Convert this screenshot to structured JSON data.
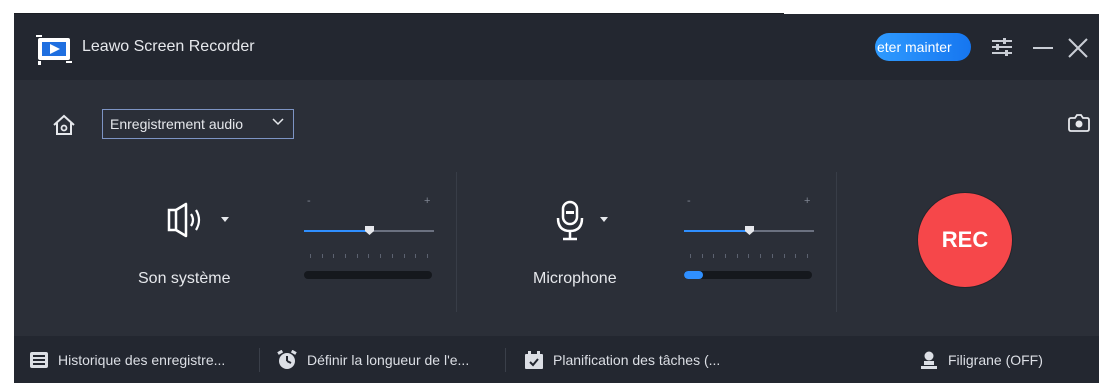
{
  "app": {
    "title": "Leawo Screen Recorder"
  },
  "header": {
    "upgrade_label": "eter mainter"
  },
  "mode": {
    "selected": "Enregistrement audio"
  },
  "sources": {
    "system": {
      "label": "Son système",
      "volume": 0.5,
      "level": 0.0,
      "minus": "-",
      "plus": "+"
    },
    "microphone": {
      "label": "Microphone",
      "volume": 0.5,
      "level": 0.15,
      "minus": "-",
      "plus": "+"
    }
  },
  "record": {
    "label": "REC"
  },
  "footer": {
    "history": "Historique des enregistre...",
    "length": "Définir la longueur de l'e...",
    "schedule": "Planification des tâches (...",
    "watermark": "Filigrane (OFF)"
  },
  "colors": {
    "accent": "#2f8fff",
    "record": "#f6474a",
    "background": "#2b2f38",
    "titlebar": "#232730"
  },
  "icons": [
    "app-logo-icon",
    "settings-icon",
    "minimize-icon",
    "close-icon",
    "home-icon",
    "chevron-down-icon",
    "camera-icon",
    "speaker-icon",
    "microphone-icon",
    "history-list-icon",
    "timer-icon",
    "calendar-icon",
    "user-icon"
  ]
}
